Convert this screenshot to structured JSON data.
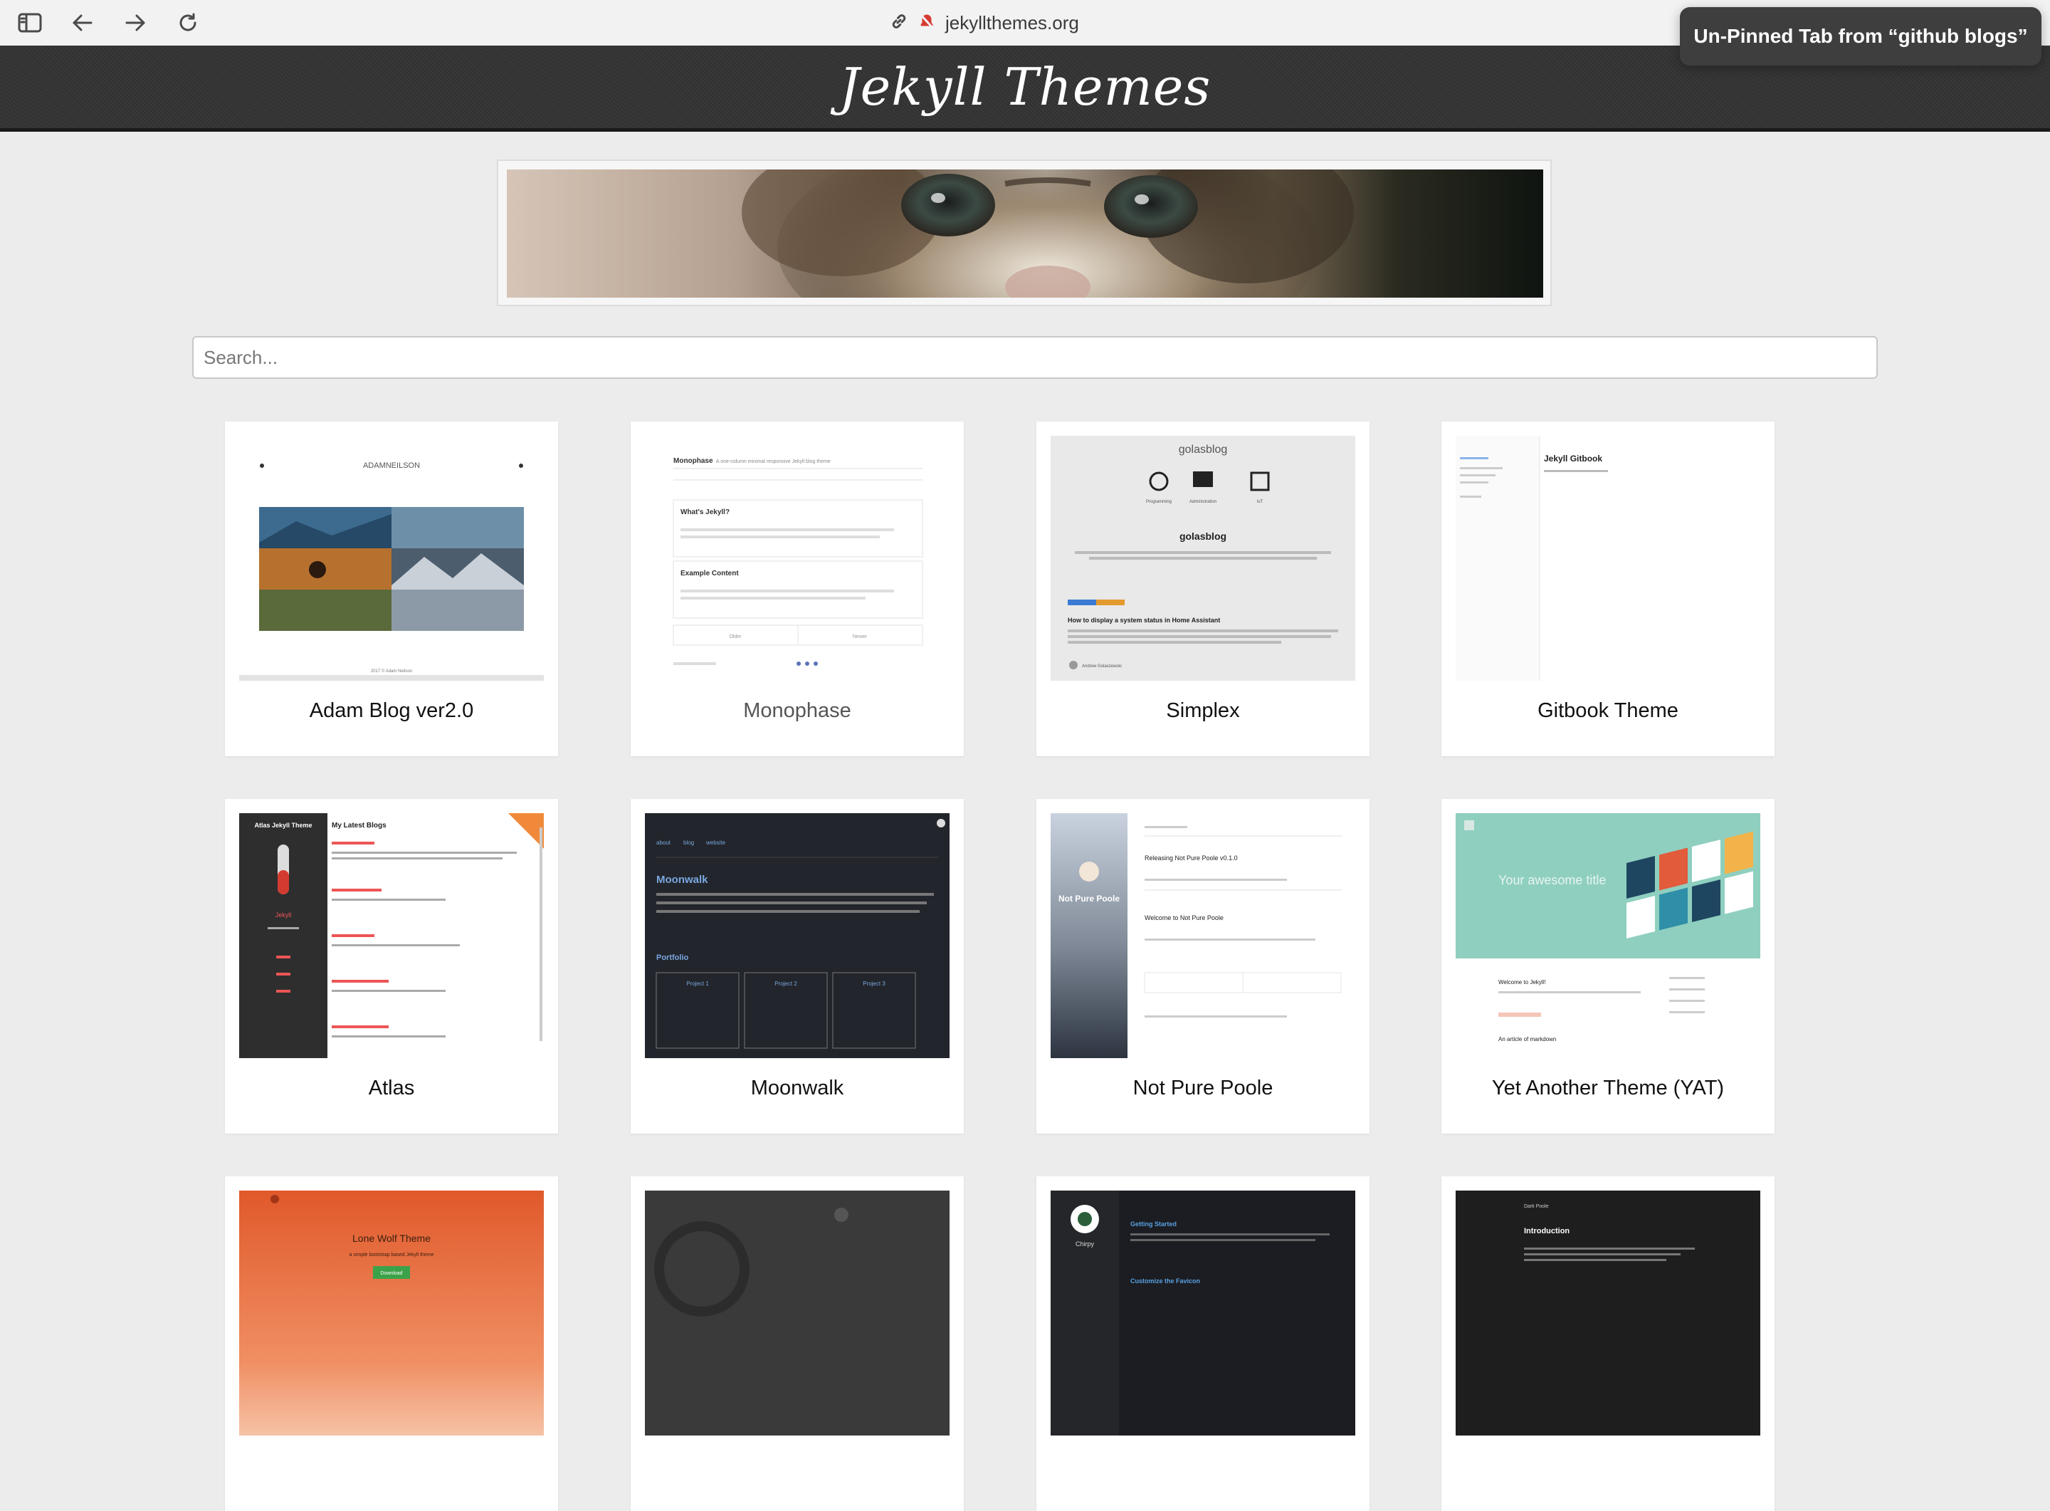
{
  "browser": {
    "url": "jekyllthemes.org",
    "tooltip": "Un-Pinned Tab from “github blogs”"
  },
  "site": {
    "title": "Jekyll Themes",
    "search_placeholder": "Search..."
  },
  "themes": [
    {
      "name": "Adam Blog ver2.0"
    },
    {
      "name": "Monophase"
    },
    {
      "name": "Simplex"
    },
    {
      "name": "Gitbook Theme"
    },
    {
      "name": "Atlas"
    },
    {
      "name": "Moonwalk"
    },
    {
      "name": "Not Pure Poole"
    },
    {
      "name": "Yet Another Theme (YAT)"
    }
  ],
  "thumb_text": {
    "adam": {
      "brand": "ADAMNEILSON",
      "footer": "2017 © Adam Neilson"
    },
    "monophase": {
      "title": "Monophase",
      "tagline": "A one-column minimal responsive Jekyll blog theme",
      "post1": "What's Jekyll?",
      "post2": "Example Content",
      "older": "Older",
      "newer": "Newer"
    },
    "simplex": {
      "brand": "golasblog",
      "heading": "golasblog",
      "post": "How to display a system status in Home Assistant",
      "author": "Andrew Golaszewski",
      "icon1": "Programming",
      "icon2": "Administration",
      "icon3": "IoT"
    },
    "gitbook": {
      "title": "Jekyll Gitbook"
    },
    "atlas": {
      "side": "Atlas Jekyll Theme",
      "heading": "My Latest Blogs",
      "brand": "Jekyll"
    },
    "moonwalk": {
      "title": "Moonwalk",
      "portfolio": "Portfolio",
      "p1": "Project 1",
      "p2": "Project 2",
      "p3": "Project 3",
      "nav1": "about",
      "nav2": "blog",
      "nav3": "website"
    },
    "npp": {
      "side": "Not Pure Poole",
      "post1": "Releasing Not Pure Poole v0.1.0",
      "post2": "Welcome to Not Pure Poole"
    },
    "yat": {
      "hero": "Your awesome title",
      "post1": "Welcome to Jekyll!",
      "post2": "An article of markdown"
    },
    "lonewolf": {
      "title": "Lone Wolf Theme",
      "sub": "a simple bootstrap based Jekyll theme",
      "btn": "Download"
    },
    "chirpy": {
      "brand": "Chirpy",
      "post": "Getting Started",
      "post2": "Customize the Favicon"
    },
    "dark": {
      "brand": "Dark Poole",
      "heading": "Introduction"
    }
  },
  "colors": {
    "header_bg": "#333333",
    "page_bg": "#ececec",
    "tooltip_bg": "#3e3e3e"
  }
}
